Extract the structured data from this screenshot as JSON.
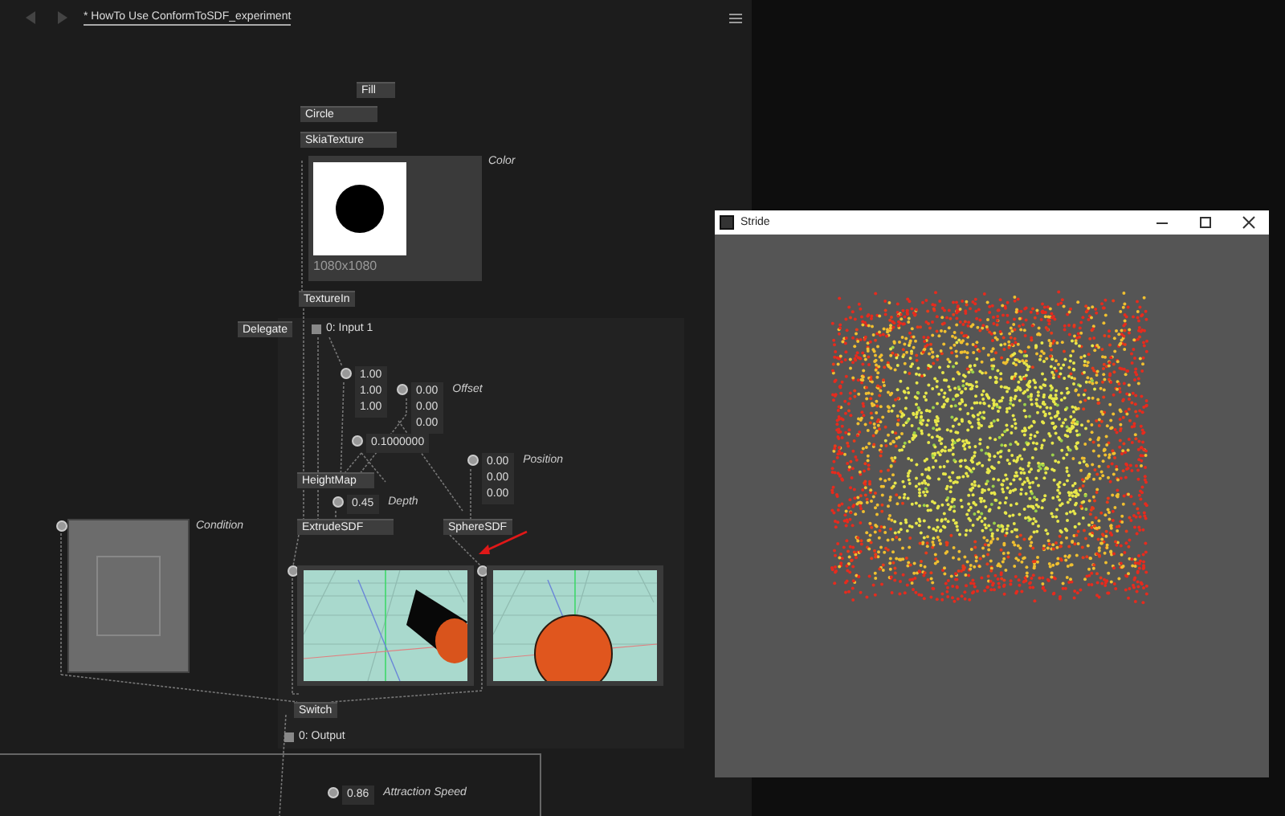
{
  "editor": {
    "breadcrumb": "* HowTo Use ConformToSDF_experiment"
  },
  "nodes": [
    {
      "label": "Fill"
    },
    {
      "label": "Circle"
    },
    {
      "label": "SkiaTexture"
    },
    {
      "label": "TextureIn"
    },
    {
      "label": "Delegate"
    },
    {
      "label": "HeightMap"
    },
    {
      "label": "ExtrudeSDF"
    },
    {
      "label": "SphereSDF"
    },
    {
      "label": "Switch"
    }
  ],
  "texture_preview": {
    "size": "1080x1080",
    "label": "Color"
  },
  "ports": [
    {
      "label": "0: Input 1"
    },
    {
      "label": "0: Output"
    }
  ],
  "inputs": [
    {
      "values": [
        "1.00",
        "1.00",
        "1.00"
      ]
    },
    {
      "values": [
        "0.00",
        "0.00",
        "0.00"
      ],
      "label": "Offset"
    },
    {
      "values": [
        "0.1000000"
      ]
    },
    {
      "values": [
        "0.45"
      ],
      "label": "Depth"
    },
    {
      "values": [
        "0.00",
        "0.00",
        "0.00"
      ],
      "label": "Position"
    },
    {
      "values": [
        "0.86"
      ],
      "label": "Attraction Speed"
    }
  ],
  "condition": {
    "label": "Condition"
  },
  "viewports": [
    {
      "kind": "cylinder"
    },
    {
      "kind": "sphere"
    }
  ],
  "render_window": {
    "title": "Stride"
  }
}
